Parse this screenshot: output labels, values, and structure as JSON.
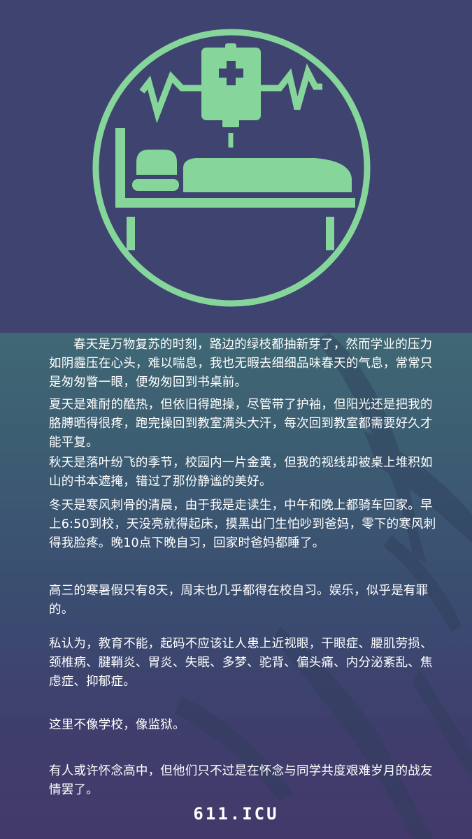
{
  "colors": {
    "hero_background": "#3f4370",
    "icon_green": "#86d69b",
    "text": "#ffffff"
  },
  "hero": {
    "icon": "hospital-bed-iv-drip-icon"
  },
  "paragraphs": [
    "春天是万物复苏的时刻，路边的绿枝都抽新芽了，然而学业的压力如阴霾压在心头，难以喘息，我也无暇去细细品味春天的气息，常常只是匆匆瞥一眼，便匆匆回到书桌前。",
    "夏天是难耐的酷热，但依旧得跑操，尽管带了护袖，但阳光还是把我的胳膊晒得很疼，跑完操回到教室满头大汗，每次回到教室都需要好久才能平复。",
    "秋天是落叶纷飞的季节，校园内一片金黄，但我的视线却被桌上堆积如山的书本遮掩，错过了那份静谧的美好。",
    "冬天是寒风刺骨的清晨，由于我是走读生，中午和晚上都骑车回家。早上6:50到校，天没亮就得起床，摸黑出门生怕吵到爸妈，零下的寒风刺得我脸疼。晚10点下晚自习，回家时爸妈都睡了。",
    "高三的寒暑假只有8天，周末也几乎都得在校自习。娱乐，似乎是有罪的。",
    "私认为，教育不能，起码不应该让人患上近视眼，干眼症、腰肌劳损、颈椎病、腱鞘炎、胃炎、失眠、多梦、驼背、偏头痛、内分泌紊乱、焦虑症、抑郁症。",
    "这里不像学校，像监狱。",
    "有人或许怀念高中，但他们只不过是在怀念与同学共度艰难岁月的战友情罢了。"
  ],
  "footer": {
    "label": "611.ICU"
  }
}
